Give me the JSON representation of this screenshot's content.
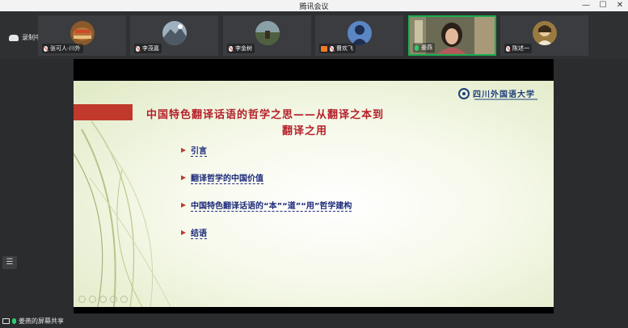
{
  "window": {
    "title": "腾讯会议",
    "minimize_glyph": "—",
    "maximize_glyph": "☐",
    "close_glyph": "✕"
  },
  "recording": {
    "label": "录制中",
    "icon": "cloud-record-icon"
  },
  "participants": [
    {
      "name": "张可人-川外",
      "mic": "muted",
      "avatar_color": "#8a5a2b"
    },
    {
      "name": "李茂嘉",
      "mic": "muted",
      "avatar_color": "#8fa0b0"
    },
    {
      "name": "李金树",
      "mic": "muted",
      "avatar_color": "#5b6b4f"
    },
    {
      "name": "曹欢飞",
      "mic": "muted",
      "share": true,
      "avatar_color": "#2c4f86"
    },
    {
      "name": "姜燕",
      "mic": "on",
      "video": true,
      "avatar_color": "#a08060"
    },
    {
      "name": "陈述一",
      "mic": "muted",
      "avatar_color": "#9a7a40"
    }
  ],
  "slide": {
    "title_line1": "中国特色翻译话语的哲学之思——从翻译之本到",
    "title_line2": "翻译之用",
    "university": "四川外国语大学",
    "bullets": [
      "引言",
      "翻译哲学的中国价值",
      "中国特色翻译话语的“本”“道”“用”哲学建构",
      "结语"
    ],
    "colors": {
      "title": "#b5202a",
      "bullet_text": "#1c2a7a",
      "accent_bar": "#c0392b",
      "logo": "#1f3f7a"
    }
  },
  "side": {
    "list_icon": "list-icon",
    "list_glyph": "☰"
  },
  "status": {
    "label": "姜燕的屏幕共享"
  }
}
